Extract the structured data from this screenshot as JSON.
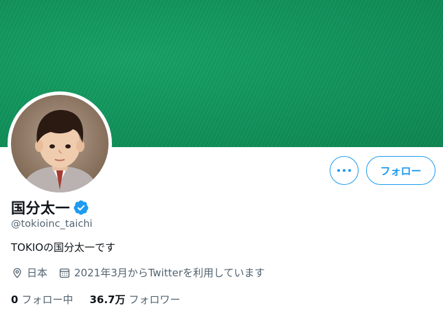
{
  "profile": {
    "name": "国分太一",
    "handle": "@tokioinc_taichi",
    "bio": "TOKIOの国分太一です",
    "location": "日本",
    "joined": "2021年3月からTwitterを利用しています",
    "verified_icon": "verified-badge-icon"
  },
  "actions": {
    "more_icon": "more-options-icon",
    "follow_label": "フォロー"
  },
  "stats": {
    "following_count": "0",
    "following_label": "フォロー中",
    "followers_count": "36.7万",
    "followers_label": "フォロワー"
  },
  "colors": {
    "banner": "#11925b",
    "accent": "#1d9bf0",
    "secondary_text": "#536471"
  }
}
